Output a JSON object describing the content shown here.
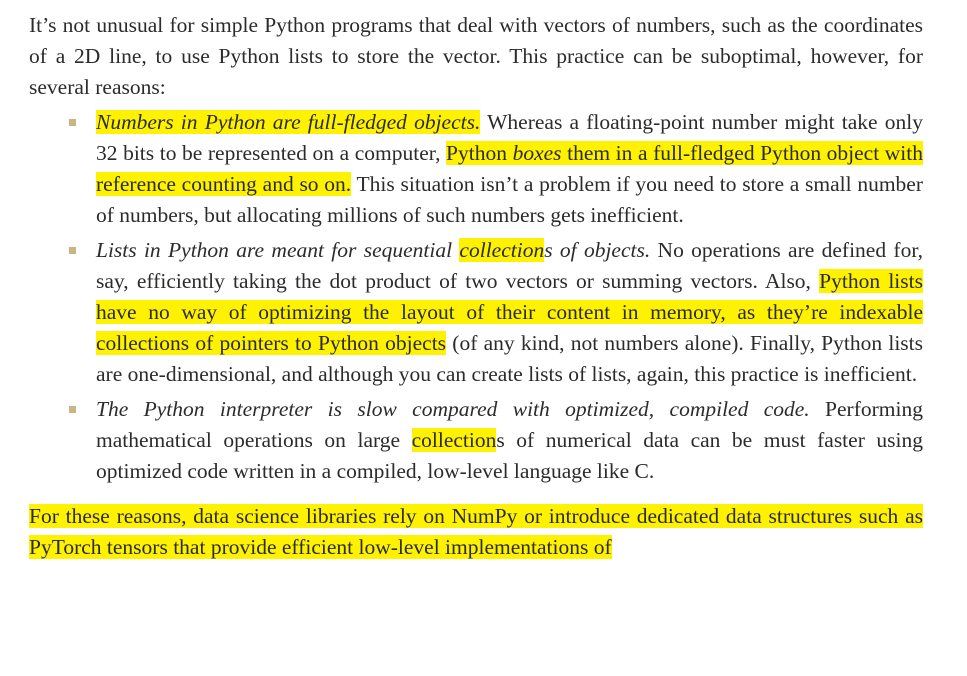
{
  "intro": "It’s not unusual for simple Python programs that deal with vectors of numbers, such as the coordinates of a 2D line, to use Python lists to store the vector. This practice can be suboptimal, however, for several reasons:",
  "bullets": [
    {
      "lead_italic": "Numbers in Python are full-fledged objects.",
      "t1": " Whereas a floating-point number might take only 32 bits to be represented on a computer, ",
      "hl_a": "Python ",
      "hl_b_italic": "boxes",
      "hl_c": " them in a full-fledged Python object with reference counting and so on.",
      "t2": " This situation isn’t a problem if you need to store a small number of numbers, but allocating millions of such numbers gets inefficient."
    },
    {
      "lead_a_italic": "Lists in Python are meant for sequential ",
      "lead_hl_italic": "collection",
      "lead_b_italic": "s of objects.",
      "t1": " No operations are defined for, say, efficiently taking the dot product of two vectors or summing vectors. Also, ",
      "hl": "Python lists have no way of optimizing the layout of their content in memory, as they’re indexable collections of pointers to Python objects",
      "t2": " (of any kind, not numbers alone). Finally, Python lists are one-dimensional, and although you can create lists of lists, again, this practice is inefficient."
    },
    {
      "lead_italic": "The Python interpreter is slow compared with optimized, compiled code.",
      "t1": " Performing mathematical operations on large ",
      "hl": "collection",
      "t2": "s of numerical data can be must faster using optimized code written in a compiled, low-level language like C."
    }
  ],
  "closing": "For these reasons, data science libraries rely on NumPy or introduce dedicated data structures such as PyTorch tensors that provide efficient low-level implementations of"
}
